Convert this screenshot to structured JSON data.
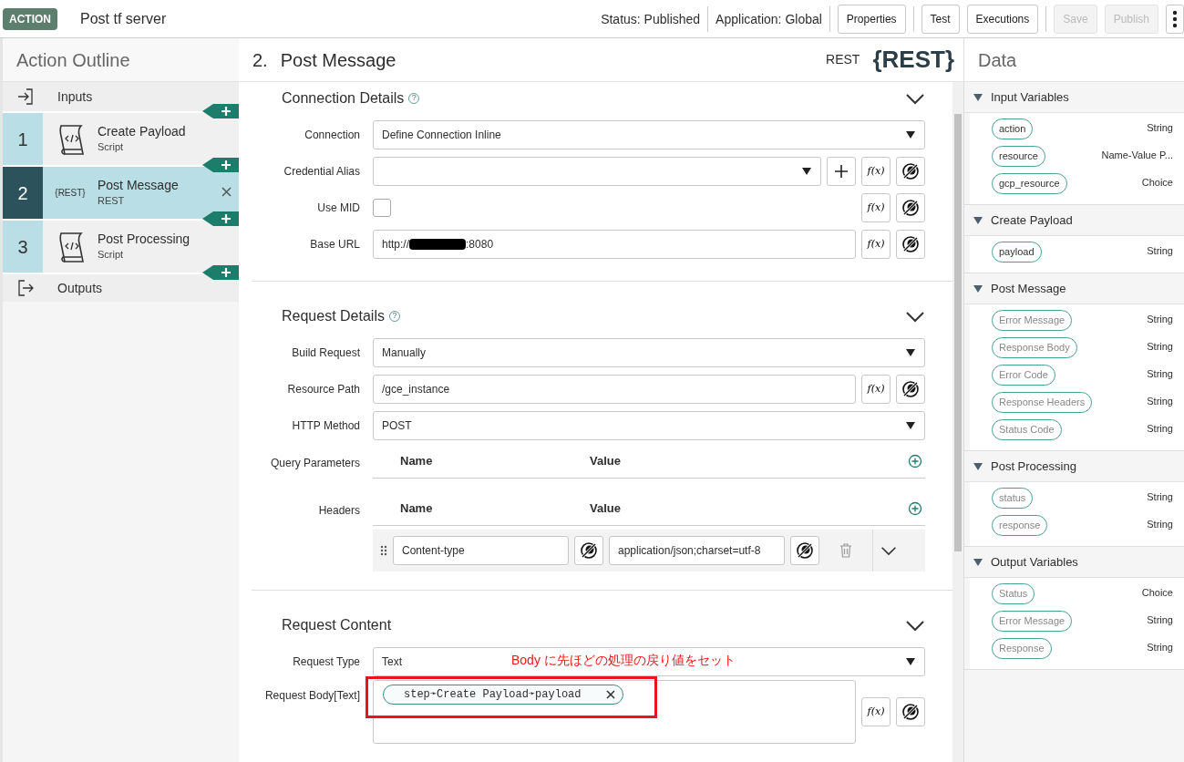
{
  "header": {
    "badge": "ACTION",
    "title": "Post tf server",
    "status": "Status: Published",
    "application": "Application: Global",
    "buttons": [
      {
        "label": "Properties",
        "disabled": false
      },
      {
        "label": "Test",
        "disabled": false
      },
      {
        "label": "Executions",
        "disabled": false
      },
      {
        "label": "Save",
        "disabled": true
      },
      {
        "label": "Publish",
        "disabled": true
      }
    ]
  },
  "outline": {
    "title": "Action Outline",
    "inputs": "Inputs",
    "outputs": "Outputs",
    "steps": [
      {
        "number": "1",
        "name": "Create Payload",
        "type": "Script",
        "kind": "script",
        "selected": false
      },
      {
        "number": "2",
        "name": "Post Message",
        "type": "REST",
        "kind": "rest",
        "icon_text": "{REST}",
        "selected": true
      },
      {
        "number": "3",
        "name": "Post Processing",
        "type": "Script",
        "kind": "script",
        "selected": false
      }
    ]
  },
  "step": {
    "number": "2.",
    "title": "Post Message",
    "type_label": "REST",
    "logo": "{REST}",
    "sections": [
      {
        "title": "Connection Details",
        "help": "?",
        "fields": [
          {
            "label": "Connection",
            "kind": "select",
            "value": "Define Connection Inline"
          },
          {
            "label": "Credential Alias",
            "kind": "select",
            "add": true,
            "formula": "f(x)",
            "data_pill": true
          },
          {
            "label": "Use MID",
            "kind": "checkbox",
            "checked": false,
            "formula": "f(x)",
            "data_pill": true
          },
          {
            "label": "Base URL",
            "kind": "text",
            "value": "http://",
            "redacted": true,
            "suffix": ":8080",
            "formula": "f(x)",
            "data_pill": true
          }
        ]
      },
      {
        "title": "Request Details",
        "help": "?",
        "fields": [
          {
            "label": "Build Request",
            "kind": "select",
            "value": "Manually"
          },
          {
            "label": "Resource Path",
            "kind": "text",
            "value": "/gce_instance",
            "formula": "f(x)",
            "data_pill": true
          },
          {
            "label": "HTTP Method",
            "kind": "select",
            "value": "POST"
          },
          {
            "label": "Query Parameters",
            "kind": "table",
            "columns": [
              "Name",
              "Value"
            ]
          },
          {
            "label": "Headers",
            "kind": "table",
            "columns": [
              "Name",
              "Value"
            ],
            "rows": [
              {
                "name": "Content-type",
                "value": "application/json;charset=utf-8"
              }
            ]
          }
        ]
      },
      {
        "title": "Request Content",
        "fields": [
          {
            "label": "Request Type",
            "kind": "select",
            "value": "Text"
          },
          {
            "label": "Request Body[Text]",
            "kind": "body",
            "pills": [
              "step➛Create Payload➛payload"
            ],
            "formula": "f(x)",
            "data_pill": true
          }
        ]
      }
    ],
    "annotation": "Body に先ほどの処理の戻り値をセット"
  },
  "data_panel": {
    "title": "Data",
    "groups": [
      {
        "title": "Input Variables",
        "expanded": true,
        "vars": [
          {
            "name": "action",
            "type": "String",
            "muted": false
          },
          {
            "name": "resource",
            "type": "Name-Value P...",
            "muted": false
          },
          {
            "name": "gcp_resource",
            "type": "Choice",
            "muted": false
          }
        ]
      },
      {
        "title": "Create Payload",
        "expanded": true,
        "vars": [
          {
            "name": "payload",
            "type": "String",
            "muted": false
          }
        ]
      },
      {
        "title": "Post Message",
        "expanded": true,
        "vars": [
          {
            "name": "Error Message",
            "type": "String",
            "muted": true
          },
          {
            "name": "Response Body",
            "type": "String",
            "muted": true
          },
          {
            "name": "Error Code",
            "type": "String",
            "muted": true
          },
          {
            "name": "Response Headers",
            "type": "String",
            "muted": true
          },
          {
            "name": "Status Code",
            "type": "String",
            "muted": true
          }
        ]
      },
      {
        "title": "Post Processing",
        "expanded": true,
        "vars": [
          {
            "name": "status",
            "type": "String",
            "muted": true
          },
          {
            "name": "response",
            "type": "String",
            "muted": true
          }
        ]
      },
      {
        "title": "Output Variables",
        "expanded": true,
        "vars": [
          {
            "name": "Status",
            "type": "Choice",
            "muted": true
          },
          {
            "name": "Error Message",
            "type": "String",
            "muted": true
          },
          {
            "name": "Response",
            "type": "String",
            "muted": true
          }
        ]
      }
    ]
  }
}
